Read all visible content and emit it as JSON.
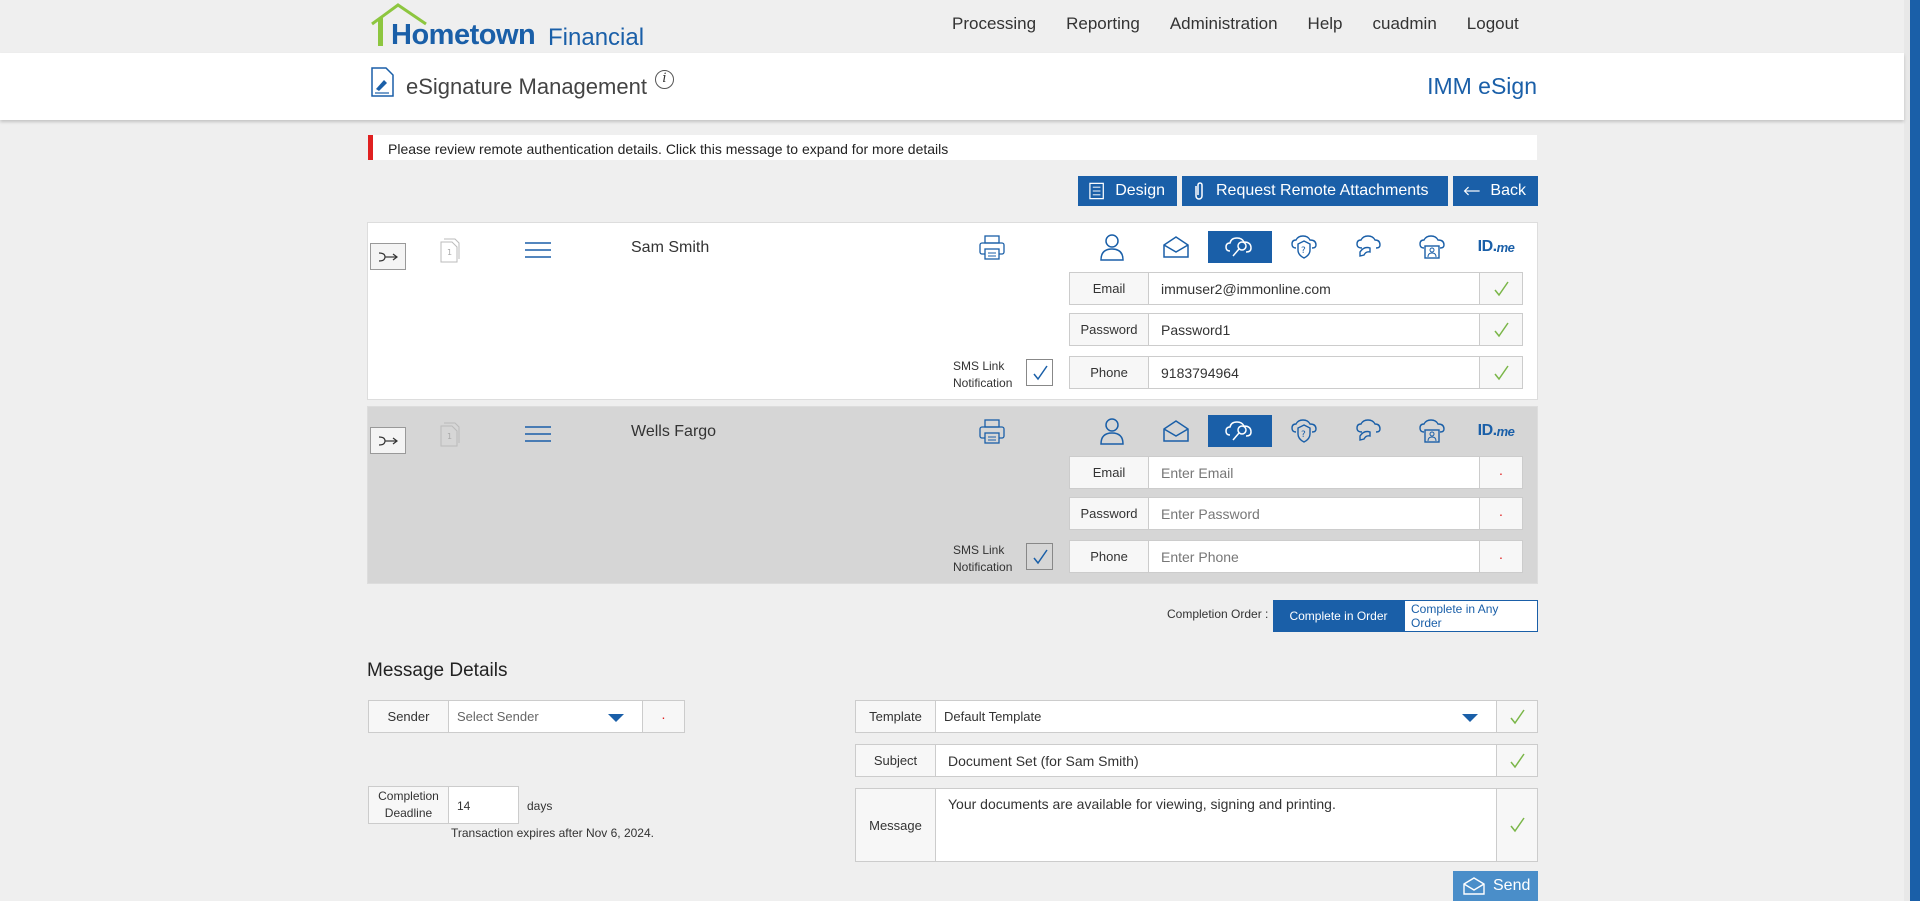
{
  "brand": {
    "name": "Hometown",
    "sub": "Financial"
  },
  "nav": [
    "Processing",
    "Reporting",
    "Administration",
    "Help",
    "cuadmin",
    "Logout"
  ],
  "header": {
    "title": "eSignature Management",
    "product": "IMM eSign"
  },
  "alert": "Please review remote authentication details. Click this message to expand for more details",
  "actions": {
    "design": "Design",
    "request": "Request Remote Attachments",
    "back": "Back"
  },
  "signers": [
    {
      "name": "Sam Smith",
      "email_label": "Email",
      "email": "immuser2@immonline.com",
      "password_label": "Password",
      "password": "Password1",
      "phone_label": "Phone",
      "phone": "9183794964",
      "sms_label_1": "SMS Link",
      "sms_label_2": "Notification",
      "idme_a": "ID.",
      "idme_b": "me"
    },
    {
      "name": "Wells Fargo",
      "email_label": "Email",
      "email_placeholder": "Enter Email",
      "password_label": "Password",
      "password_placeholder": "Enter Password",
      "phone_label": "Phone",
      "phone_placeholder": "Enter Phone",
      "sms_label_1": "SMS Link",
      "sms_label_2": "Notification",
      "idme_a": "ID.",
      "idme_b": "me"
    }
  ],
  "completion": {
    "label": "Completion Order :",
    "in_order": "Complete in Order",
    "any_order": "Complete in Any Order"
  },
  "message_details": {
    "title": "Message Details",
    "sender_label": "Sender",
    "sender_value": "Select Sender",
    "deadline_label_1": "Completion",
    "deadline_label_2": "Deadline",
    "deadline_value": "14",
    "days": "days",
    "expires": "Transaction expires after Nov 6, 2024.",
    "template_label": "Template",
    "template_value": "Default Template",
    "subject_label": "Subject",
    "subject_value": "Document Set (for Sam Smith)",
    "message_label": "Message",
    "message_value": "Your documents are available for viewing, signing and printing.",
    "send": "Send"
  },
  "colors": {
    "accent": "#1a5fa8",
    "alert": "#e02020",
    "check": "#7ab648"
  }
}
